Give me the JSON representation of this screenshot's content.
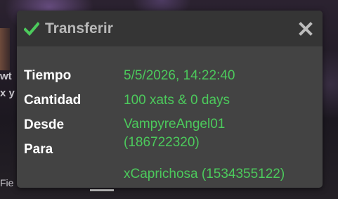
{
  "background": {
    "fragment_1": "wt",
    "fragment_2": "x y",
    "fragment_3": "Fie"
  },
  "dialog": {
    "title": "Transferir",
    "icon": "check-icon",
    "close_icon": "close-icon",
    "accent_color": "#4cca5c",
    "rows": {
      "tiempo": {
        "label": "Tiempo",
        "value": "5/5/2026, 14:22:40"
      },
      "cantidad": {
        "label": "Cantidad",
        "value": "100 xats & 0 days"
      },
      "desde": {
        "label": "Desde",
        "value_line1": "VampyreAngel01",
        "value_line2": "(186722320)"
      },
      "para": {
        "label": "Para",
        "value": "xCaprichosa (1534355122)"
      }
    }
  }
}
